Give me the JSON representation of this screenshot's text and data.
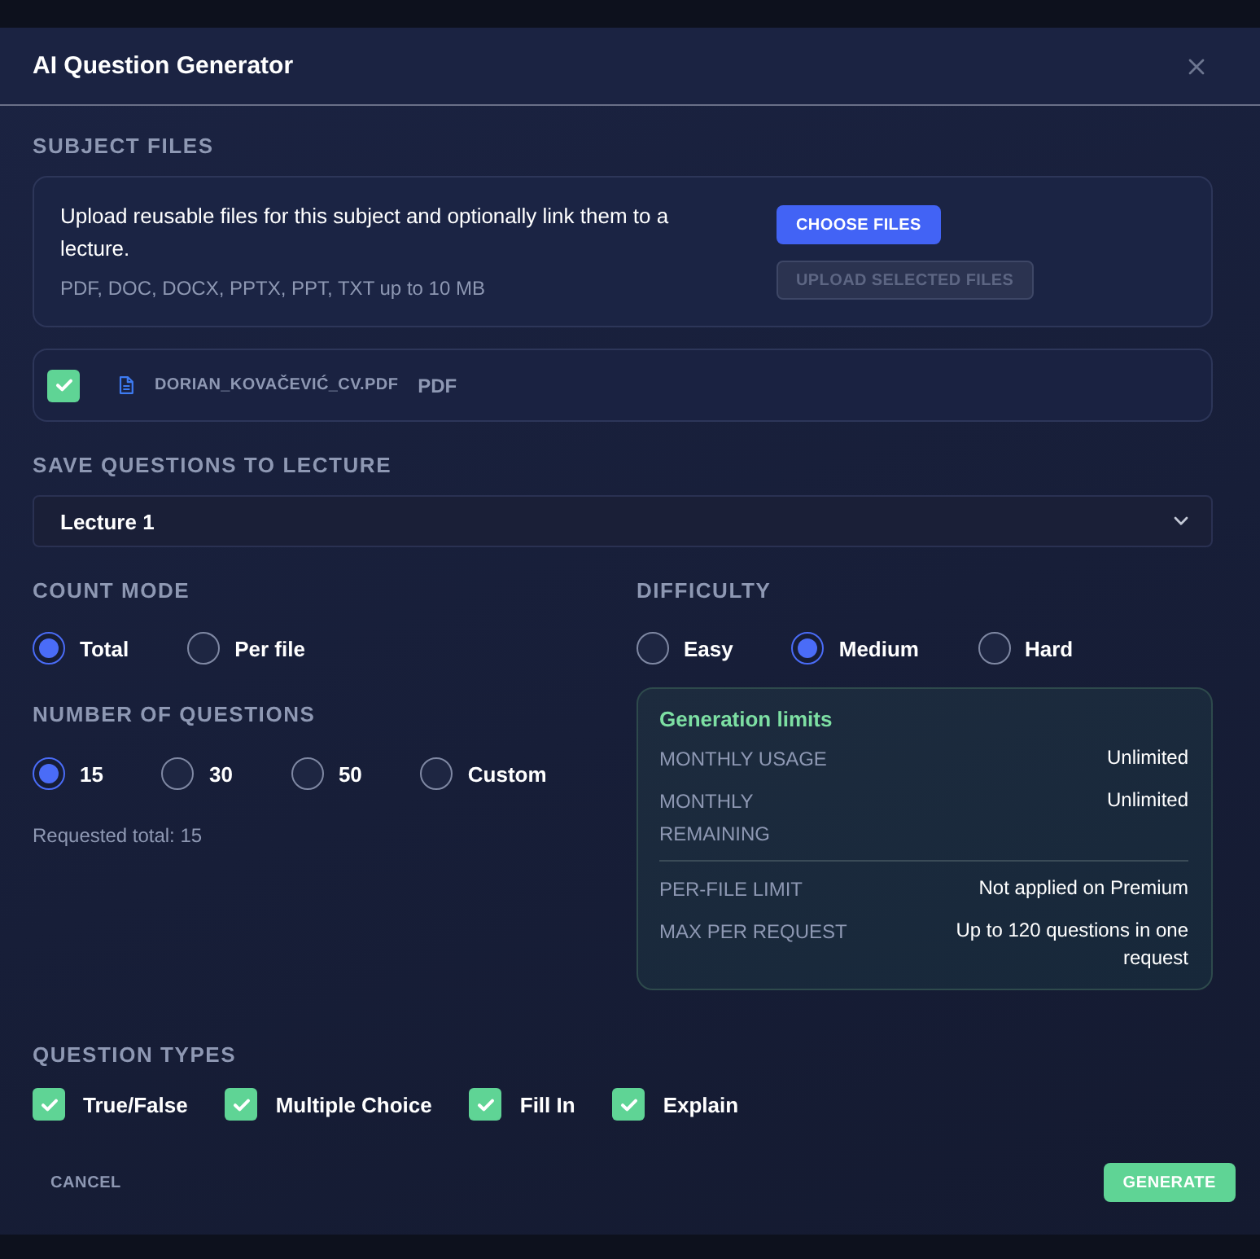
{
  "dialog": {
    "title": "AI Question Generator"
  },
  "subject_files": {
    "heading": "SUBJECT FILES",
    "description": "Upload reusable files for this subject and optionally link them to a lecture.",
    "hint": "PDF, DOC, DOCX, PPTX, PPT, TXT up to 10 MB",
    "buttons": [
      {
        "label": "CHOOSE FILES",
        "disabled": false
      },
      {
        "label": "UPLOAD SELECTED FILES",
        "disabled": true
      }
    ],
    "files": [
      {
        "name": "DORIAN_KOVAČEVIĆ_CV.PDF",
        "type": "PDF",
        "checked": true
      }
    ]
  },
  "lecture": {
    "heading": "SAVE QUESTIONS TO LECTURE",
    "value": "Lecture 1"
  },
  "count_mode": {
    "heading": "COUNT MODE",
    "options": [
      {
        "label": "Total",
        "selected": true
      },
      {
        "label": "Per file",
        "selected": false
      }
    ]
  },
  "number_of_questions": {
    "heading": "NUMBER OF QUESTIONS",
    "options": [
      {
        "label": "15",
        "selected": true
      },
      {
        "label": "30",
        "selected": false
      },
      {
        "label": "50",
        "selected": false
      },
      {
        "label": "Custom",
        "selected": false
      }
    ],
    "summary": "Requested total: 15"
  },
  "difficulty": {
    "heading": "DIFFICULTY",
    "options": [
      {
        "label": "Easy",
        "selected": false
      },
      {
        "label": "Medium",
        "selected": true
      },
      {
        "label": "Hard",
        "selected": false
      }
    ]
  },
  "generation_limits": {
    "title": "Generation limits",
    "groups": [
      [
        {
          "label": "MONTHLY USAGE",
          "value": "Unlimited"
        },
        {
          "label": "MONTHLY REMAINING",
          "value": "Unlimited"
        }
      ],
      [
        {
          "label": "PER-FILE LIMIT",
          "value": "Not applied on Premium"
        },
        {
          "label": "MAX PER REQUEST",
          "value": "Up to 120 questions in one request"
        }
      ]
    ]
  },
  "question_types": {
    "heading": "QUESTION TYPES",
    "items": [
      {
        "label": "True/False",
        "checked": true
      },
      {
        "label": "Multiple Choice",
        "checked": true
      },
      {
        "label": "Fill In",
        "checked": true
      },
      {
        "label": "Explain",
        "checked": true
      }
    ]
  },
  "footer": {
    "cancel": "CANCEL",
    "generate": "GENERATE"
  }
}
